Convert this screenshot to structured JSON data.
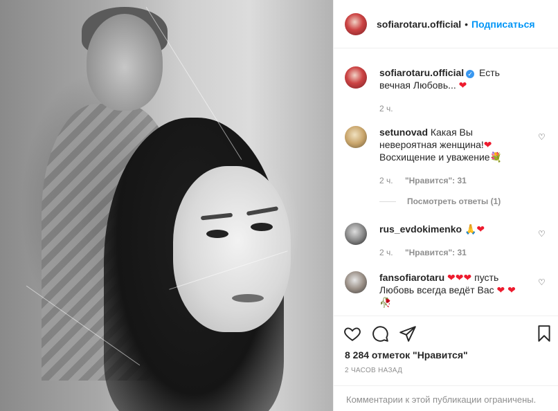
{
  "post": {
    "username": "sofiarotaru.official",
    "dot": "•",
    "follow_label": "Подписаться",
    "caption_text": "Есть вечная Любовь...",
    "caption_emoji": "❤",
    "caption_time": "2 ч."
  },
  "comments": [
    {
      "username": "setunovad",
      "text": "Какая Вы невероятная женщина!",
      "emoji1": "❤",
      "text2": "Восхищение и уважение",
      "emoji2": "💐",
      "time": "2 ч.",
      "likes": "\"Нравится\": 31",
      "view_replies": "Посмотреть ответы (1)"
    },
    {
      "username": "rus_evdokimenko",
      "text": "🙏",
      "emoji1": "❤",
      "time": "2 ч.",
      "likes": "\"Нравится\": 31"
    },
    {
      "username": "fansofiarotaru",
      "text": "❤❤❤",
      "text2": " пусть Любовь всегда ведёт Вас",
      "emoji2": "❤",
      "text3": "❤🥀"
    }
  ],
  "footer": {
    "likes_count": "8 284 отметок \"Нравится\"",
    "time_ago": "2 ЧАСОВ НАЗАД",
    "comments_limited": "Комментарии к этой публикации ограничены."
  },
  "icons": [
    "heart-icon",
    "comment-icon",
    "share-icon",
    "bookmark-icon",
    "verified-badge-icon",
    "comment-like-icon"
  ],
  "colors": {
    "accent": "#0095f6",
    "heart": "#ed1b2e",
    "muted": "#8e8e8e",
    "text": "#262626"
  }
}
